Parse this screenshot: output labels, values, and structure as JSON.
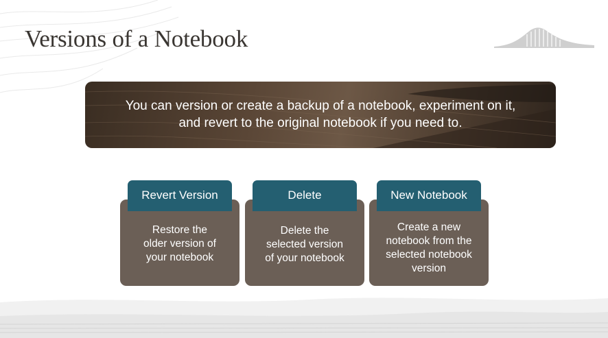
{
  "slide": {
    "title": "Versions of a Notebook",
    "banner_line1": "You can version or create a backup of a notebook, experiment on it,",
    "banner_line2": "and revert to the original notebook if you need to."
  },
  "cards": [
    {
      "header": "Revert Version",
      "lines": [
        "Restore the",
        "older version of",
        "your notebook"
      ]
    },
    {
      "header": "Delete",
      "lines": [
        "Delete the",
        "selected version",
        "of your notebook"
      ]
    },
    {
      "header": "New Notebook",
      "lines": [
        "Create a new",
        "notebook from the",
        "selected notebook",
        "version"
      ]
    }
  ],
  "colors": {
    "tab": "#245f71",
    "card_body": "#6b5f56",
    "title": "#3a3632"
  }
}
